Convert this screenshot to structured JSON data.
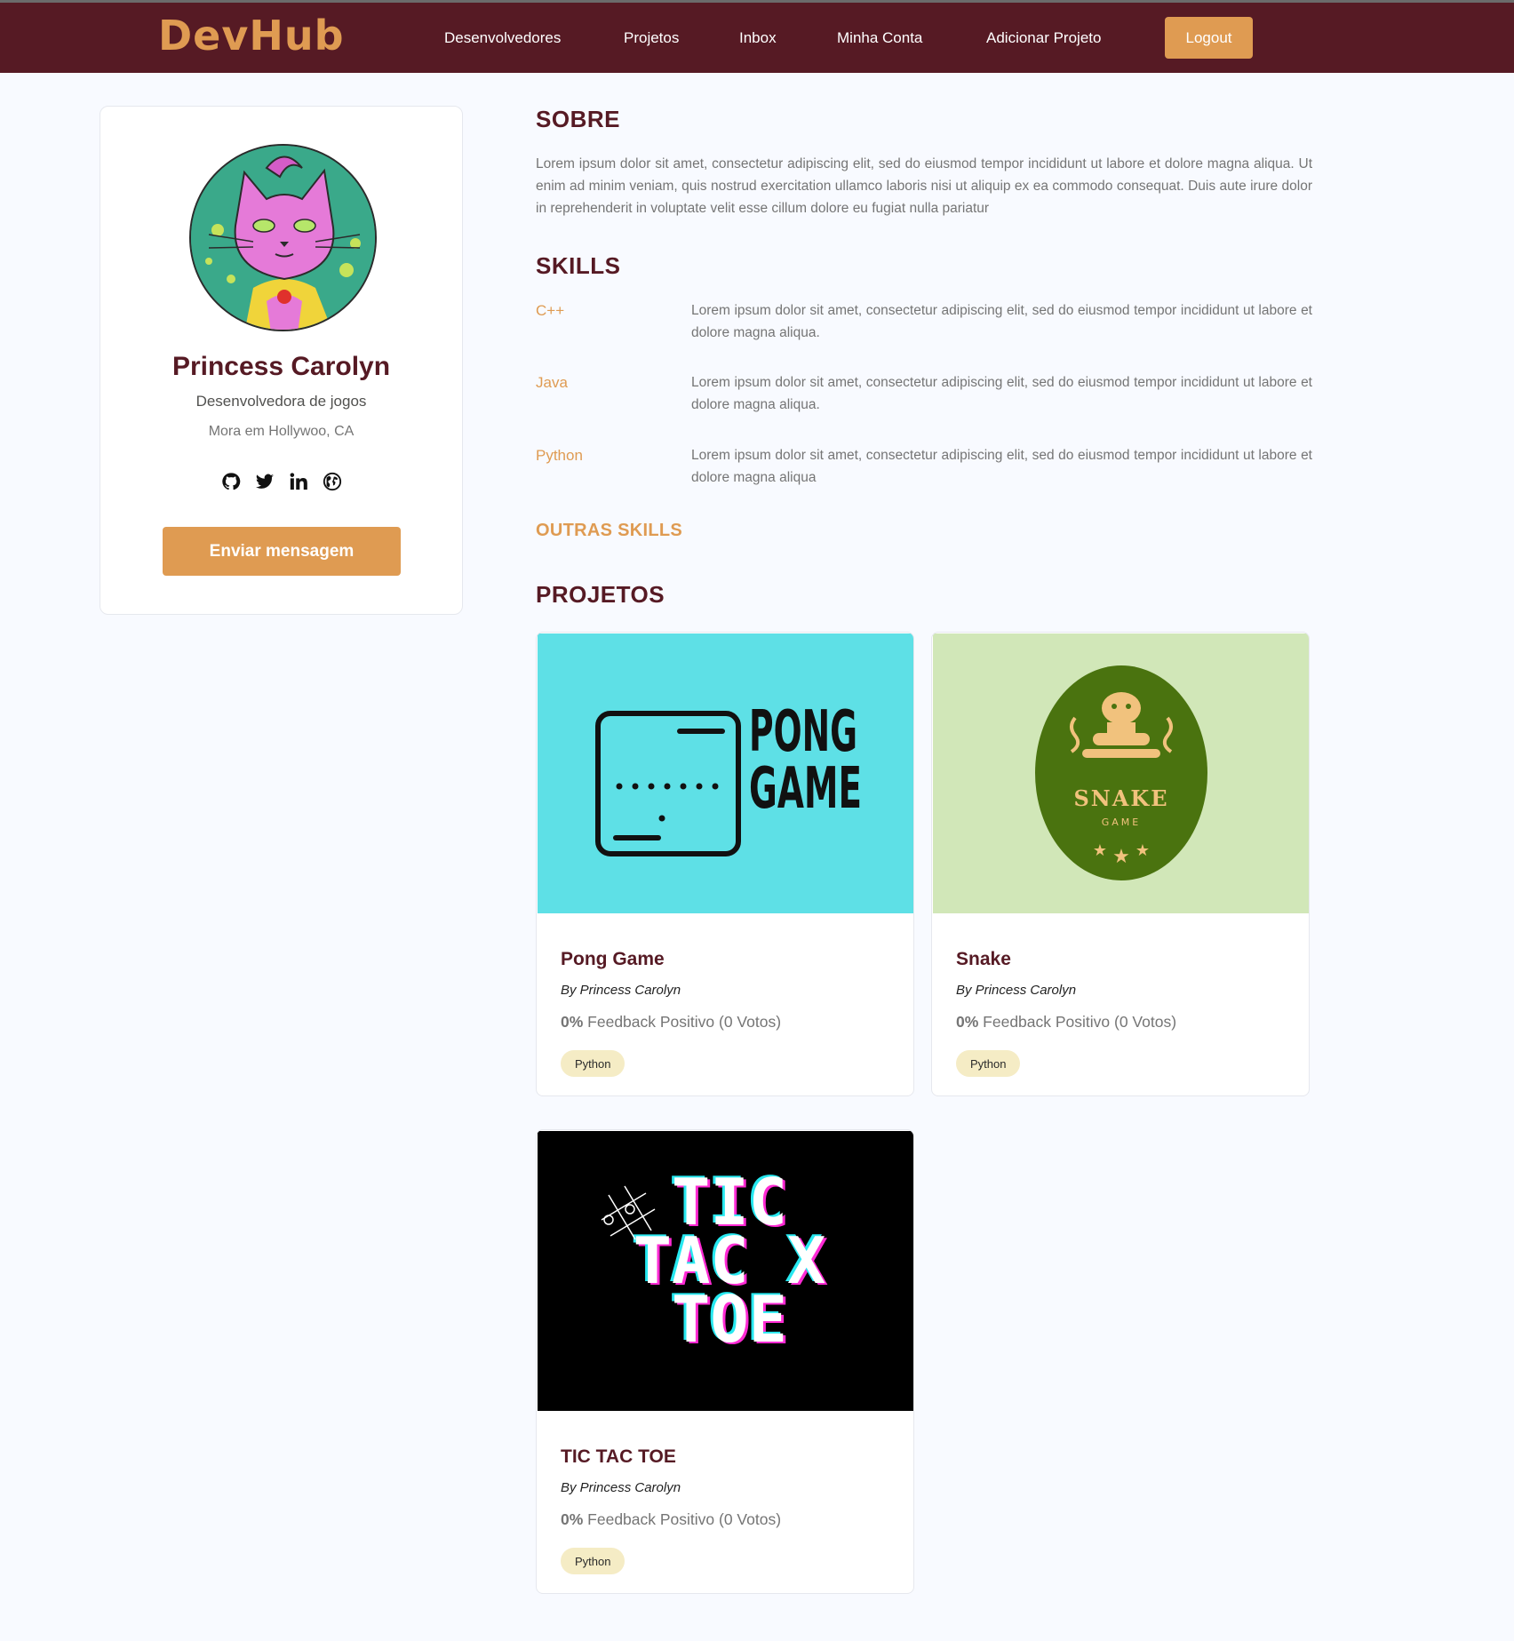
{
  "nav": {
    "logo": "DevHub",
    "links": [
      "Desenvolvedores",
      "Projetos",
      "Inbox",
      "Minha Conta",
      "Adicionar Projeto"
    ],
    "logout": "Logout"
  },
  "profile": {
    "name": "Princess Carolyn",
    "role": "Desenvolvedora de jogos",
    "location": "Mora em Hollywoo, CA",
    "socials": [
      "github-icon",
      "twitter-icon",
      "linkedin-icon",
      "website-icon"
    ],
    "send_message": "Enviar mensagem"
  },
  "about": {
    "title": "SOBRE",
    "text": "Lorem ipsum dolor sit amet, consectetur adipiscing elit, sed do eiusmod tempor incididunt ut labore et dolore magna aliqua. Ut enim ad minim veniam, quis nostrud exercitation ullamco laboris nisi ut aliquip ex ea commodo consequat. Duis aute irure dolor in reprehenderit in voluptate velit esse cillum dolore eu fugiat nulla pariatur"
  },
  "skills": {
    "title": "SKILLS",
    "items": [
      {
        "name": "C++",
        "description": "Lorem ipsum dolor sit amet, consectetur adipiscing elit, sed do eiusmod tempor incididunt ut labore et dolore magna aliqua."
      },
      {
        "name": "Java",
        "description": "Lorem ipsum dolor sit amet, consectetur adipiscing elit, sed do eiusmod tempor incididunt ut labore et dolore magna aliqua."
      },
      {
        "name": "Python",
        "description": "Lorem ipsum dolor sit amet, consectetur adipiscing elit, sed do eiusmod tempor incididunt ut labore et dolore magna aliqua"
      }
    ],
    "other_title": "OUTRAS SKILLS"
  },
  "projects": {
    "title": "PROJETOS",
    "items": [
      {
        "title": "Pong Game",
        "author": "By Princess Carolyn",
        "feedback_pct": "0%",
        "feedback_text": " Feedback Positivo (0 Votos)",
        "tag": "Python",
        "thumb_text": [
          "PONG",
          "GAME"
        ]
      },
      {
        "title": "Snake",
        "author": "By Princess Carolyn",
        "feedback_pct": "0%",
        "feedback_text": " Feedback Positivo (0 Votos)",
        "tag": "Python",
        "thumb_text": [
          "SNAKE",
          "GAME"
        ]
      },
      {
        "title": "TIC TAC TOE",
        "author": "By Princess Carolyn",
        "feedback_pct": "0%",
        "feedback_text": " Feedback Positivo (0 Votos)",
        "tag": "Python",
        "thumb_text": [
          "TIC",
          "TAC X",
          "TOE"
        ]
      }
    ]
  },
  "colors": {
    "nav_bg": "#561a24",
    "accent": "#df9b52",
    "page_bg": "#f8faff",
    "tag_bg": "#f5ecc5",
    "pong_bg": "#5ee0e6",
    "snake_bg": "#d1e7b8",
    "snake_badge": "#4a730f",
    "tictactoe_bg": "#000000"
  }
}
